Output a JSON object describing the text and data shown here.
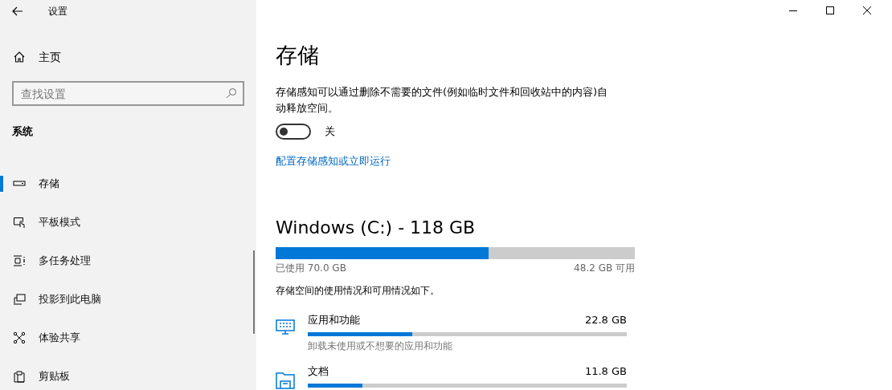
{
  "window": {
    "title": "设置"
  },
  "sidebar": {
    "home": "主页",
    "search": {
      "placeholder": "查找设置"
    },
    "section": "系统",
    "items": [
      {
        "label": "存储",
        "kind": "storage",
        "selected": true
      },
      {
        "label": "平板模式",
        "kind": "tablet",
        "selected": false
      },
      {
        "label": "多任务处理",
        "kind": "multitask",
        "selected": false
      },
      {
        "label": "投影到此电脑",
        "kind": "project",
        "selected": false
      },
      {
        "label": "体验共享",
        "kind": "share",
        "selected": false
      },
      {
        "label": "剪贴板",
        "kind": "clipboard",
        "selected": false
      }
    ]
  },
  "main": {
    "title": "存储",
    "description": "存储感知可以通过删除不需要的文件(例如临时文件和回收站中的内容)自动释放空间。",
    "toggle": {
      "on": false,
      "label": "关"
    },
    "link": "配置存储感知或立即运行",
    "drive": {
      "title": "Windows (C:) - 118 GB",
      "level": 0.593,
      "used": "已使用 70.0 GB",
      "free": "48.2 GB 可用"
    },
    "usage_note": "存储空间的使用情况和可用情况如下。",
    "categories": [
      {
        "kind": "apps",
        "name": "应用和功能",
        "size": "22.8 GB",
        "level": 0.327,
        "hint": "卸载未使用或不想要的应用和功能"
      },
      {
        "kind": "documents",
        "name": "文档",
        "size": "11.8 GB",
        "level": 0.171
      }
    ]
  }
}
